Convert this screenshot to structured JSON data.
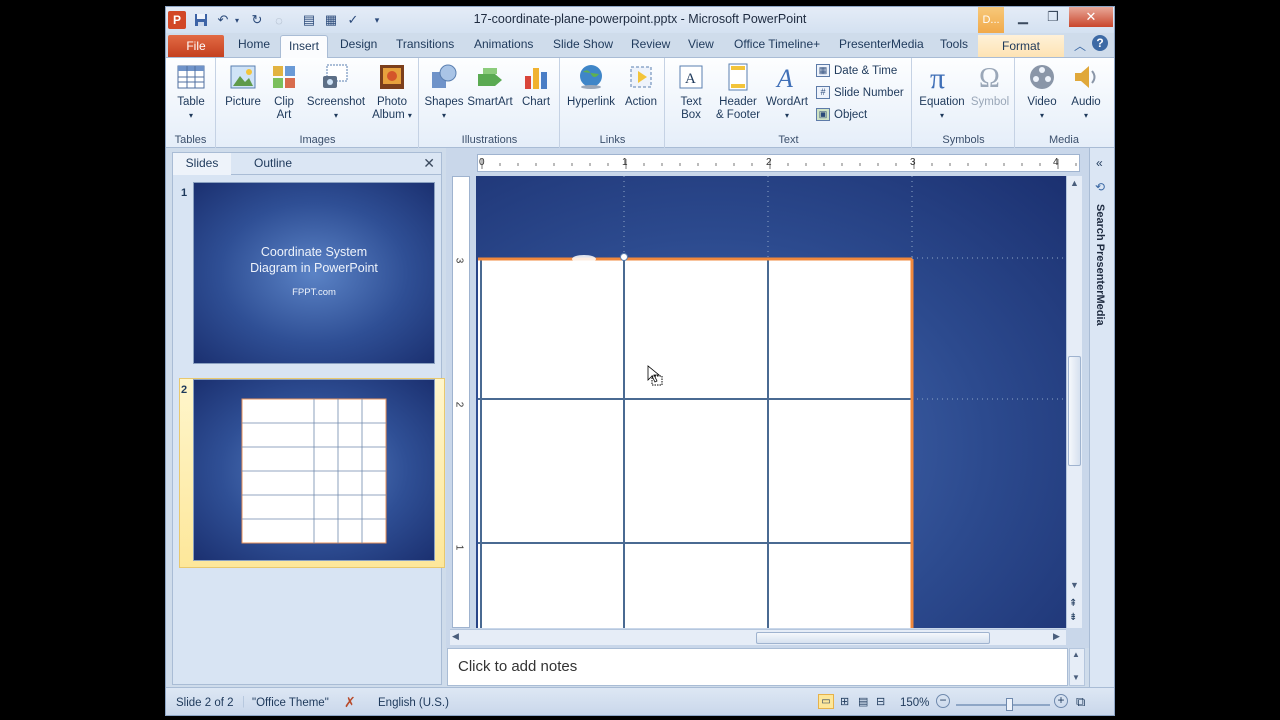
{
  "window": {
    "title": "17-coordinate-plane-powerpoint.pptx - Microsoft PowerPoint",
    "app_icon": "P",
    "context_tab_header": "D..."
  },
  "tabs": [
    "File",
    "Home",
    "Insert",
    "Design",
    "Transitions",
    "Animations",
    "Slide Show",
    "Review",
    "View",
    "Office Timeline+",
    "PresenterMedia",
    "Tools",
    "Format"
  ],
  "active_tab": "Insert",
  "ribbon": {
    "groups": {
      "tables": "Tables",
      "images": "Images",
      "illustrations": "Illustrations",
      "links": "Links",
      "text": "Text",
      "symbols": "Symbols",
      "media": "Media"
    },
    "buttons": {
      "table": "Table",
      "picture": "Picture",
      "clip_art": "Clip Art",
      "screenshot": "Screenshot",
      "photo_album": "Photo Album",
      "shapes": "Shapes",
      "smartart": "SmartArt",
      "chart": "Chart",
      "hyperlink": "Hyperlink",
      "action": "Action",
      "text_box": "Text Box",
      "header_footer": "Header & Footer",
      "wordart": "WordArt",
      "date_time": "Date & Time",
      "slide_number": "Slide Number",
      "object": "Object",
      "equation": "Equation",
      "symbol": "Symbol",
      "video": "Video",
      "audio": "Audio"
    }
  },
  "left_pane": {
    "tab_slides": "Slides",
    "tab_outline": "Outline",
    "slide1": {
      "number": "1",
      "title_line1": "Coordinate System",
      "title_line2": "Diagram in PowerPoint",
      "subtitle": "FPPT.com"
    },
    "slide2": {
      "number": "2"
    }
  },
  "ruler": {
    "h_labels": [
      "0",
      "1",
      "2",
      "3",
      "4"
    ],
    "v_labels": [
      "3",
      "2",
      "1"
    ]
  },
  "right_panel": {
    "label": "Search PresenterMedia"
  },
  "notes": {
    "placeholder": "Click to add notes"
  },
  "status_bar": {
    "slide_info": "Slide 2 of 2",
    "theme": "\"Office Theme\"",
    "language": "English (U.S.)",
    "zoom": "150%"
  },
  "colors": {
    "slide_bg": "#2c4a8e",
    "grid_line": "#4a6a92",
    "selection": "#f0883c",
    "file_tab": "#c4401f"
  }
}
